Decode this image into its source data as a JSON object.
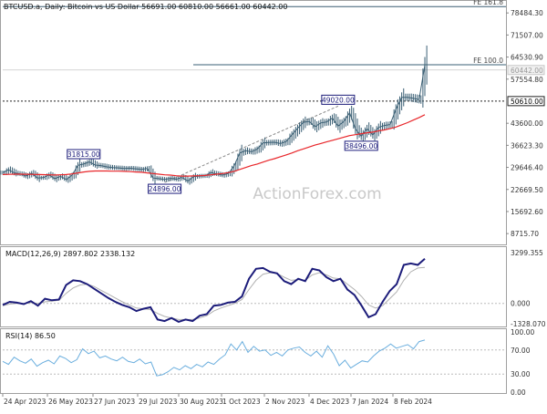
{
  "header": {
    "symbol_line": "BTCUSD.a, Daily:  Bitcoin vs US Dollar  56691.00 60810.00 56661.00 60442.00"
  },
  "watermark": "ActionForex.com",
  "colors": {
    "price_bar": "#3a5f74",
    "moving_average": "#e8262a",
    "macd_line": "#1c1c7a",
    "macd_signal": "#b0b0b0",
    "rsi_line": "#6aaede",
    "fib_line": "#3a5f74",
    "grid": "#d9d9d9",
    "label_box": "#1c1c7a"
  },
  "chart_data": [
    {
      "type": "line",
      "panel": "price",
      "yaxis_ticks": [
        "78484.30",
        "71507.00",
        "64530.90",
        "57554.80",
        "50610.00",
        "43600.00",
        "36623.30",
        "29646.40",
        "22669.50",
        "15692.60",
        "8715.70"
      ],
      "ylim": [
        5300,
        82000
      ],
      "x_dates": [
        "24 Apr 2023",
        "26 May 2023",
        "27 Jun 2023",
        "29 Jul 2023",
        "30 Aug 2023",
        "1 Oct 2023",
        "2 Nov 2023",
        "4 Dec 2023",
        "7 Jan 2024",
        "8 Feb 2024"
      ],
      "series": [
        {
          "values": [
            28000,
            28900,
            27900,
            27600,
            26900,
            27800,
            26300,
            26400,
            27300,
            26100,
            26800,
            25800,
            27200,
            30300,
            30700,
            31400,
            30400,
            30200,
            29800,
            29600,
            29500,
            29300,
            29400,
            29200,
            29000,
            29300,
            26300,
            26100,
            25800,
            26200,
            25900,
            26500,
            25300,
            26700,
            26900,
            27000,
            28000,
            27600,
            27200,
            27700,
            30000,
            34200,
            34900,
            34600,
            35400,
            37400,
            37500,
            37600,
            37200,
            37800,
            39900,
            42000,
            43900,
            44200,
            42500,
            43700,
            44000,
            45200,
            42700,
            44200,
            46900,
            41800,
            39500,
            41900,
            39900,
            42300,
            42900,
            43200,
            48000,
            51800,
            51800,
            51500,
            51100,
            62000
          ]
        },
        {
          "values": [
            27400,
            27450,
            27500,
            27500,
            27480,
            27450,
            27400,
            27350,
            27300,
            27250,
            27300,
            27400,
            27600,
            27900,
            28200,
            28400,
            28500,
            28500,
            28500,
            28450,
            28450,
            28400,
            28300,
            28200,
            28100,
            27900,
            27700,
            27500,
            27300,
            27200,
            27000,
            26900,
            26900,
            26950,
            27000,
            27100,
            27300,
            27500,
            27700,
            28000,
            28400,
            29000,
            29600,
            30200,
            30700,
            31300,
            31900,
            32400,
            33000,
            33600,
            34200,
            34900,
            35500,
            36100,
            36700,
            37200,
            37700,
            38200,
            38700,
            39200,
            39700,
            40000,
            40300,
            40600,
            40800,
            41200,
            41500,
            41900,
            42400,
            43100,
            43800,
            44600,
            45400,
            46300
          ]
        }
      ],
      "annotations": [
        {
          "text": "31815.00",
          "x_index": 14,
          "y": 31815
        },
        {
          "text": "24896.00",
          "x_index": 28,
          "y": 24896
        },
        {
          "text": "49020.00",
          "x_index": 58,
          "y": 49020
        },
        {
          "text": "38496.00",
          "x_index": 62,
          "y": 38496
        }
      ],
      "fib_levels": [
        {
          "label": "FE 161.8",
          "value": 80500
        },
        {
          "label": "FE 100.0",
          "value": 62100
        }
      ],
      "horizontal_lines": [
        {
          "label": "50610.00",
          "value": 50610
        },
        {
          "label": "60442.00",
          "value": 60442
        }
      ]
    },
    {
      "type": "line",
      "panel": "macd",
      "title": "MACD(12,26,9) 2897.802 2338.132",
      "yaxis_ticks": [
        "3299.355",
        "0.000",
        "-1328.070"
      ],
      "ylim": [
        -1500,
        3600
      ],
      "series": [
        {
          "values": [
            -100,
            100,
            50,
            -50,
            150,
            -150,
            300,
            200,
            250,
            1200,
            1500,
            1450,
            1250,
            950,
            650,
            350,
            100,
            -100,
            -250,
            -500,
            -350,
            -250,
            -1050,
            -1150,
            -950,
            -1200,
            -1050,
            -1150,
            -800,
            -700,
            -150,
            -100,
            50,
            100,
            450,
            1600,
            2250,
            2300,
            2050,
            1950,
            1450,
            1250,
            1600,
            1450,
            2250,
            2150,
            1700,
            1450,
            1600,
            900,
            550,
            -150,
            -900,
            -700,
            100,
            800,
            1250,
            2500,
            2600,
            2500,
            2900
          ]
        },
        {
          "values": [
            -150,
            -50,
            0,
            0,
            50,
            0,
            100,
            150,
            200,
            650,
            1000,
            1200,
            1250,
            1100,
            850,
            600,
            350,
            100,
            -100,
            -300,
            -350,
            -400,
            -650,
            -850,
            -950,
            -1050,
            -1050,
            -1050,
            -950,
            -800,
            -500,
            -300,
            -150,
            0,
            250,
            900,
            1500,
            1900,
            2000,
            1950,
            1700,
            1500,
            1550,
            1500,
            1850,
            2000,
            1850,
            1650,
            1600,
            1250,
            900,
            450,
            -100,
            -300,
            -150,
            300,
            750,
            1500,
            2050,
            2300,
            2340
          ]
        }
      ]
    },
    {
      "type": "line",
      "panel": "rsi",
      "title": "RSI(14) 86.50",
      "yaxis_ticks": [
        "100.00",
        "70.00",
        "30.00",
        "0.00"
      ],
      "ylim": [
        0,
        100
      ],
      "series": [
        {
          "values": [
            51,
            46,
            58,
            52,
            48,
            55,
            43,
            49,
            53,
            47,
            60,
            56,
            49,
            54,
            72,
            64,
            68,
            57,
            60,
            55,
            52,
            58,
            51,
            49,
            55,
            47,
            50,
            27,
            29,
            34,
            41,
            37,
            44,
            39,
            46,
            42,
            50,
            46,
            55,
            62,
            80,
            70,
            84,
            66,
            76,
            68,
            70,
            61,
            66,
            60,
            70,
            73,
            75,
            66,
            60,
            68,
            58,
            77,
            63,
            44,
            53,
            40,
            46,
            52,
            50,
            60,
            68,
            73,
            80,
            73,
            76,
            79,
            72,
            84,
            86.5
          ]
        }
      ]
    }
  ]
}
